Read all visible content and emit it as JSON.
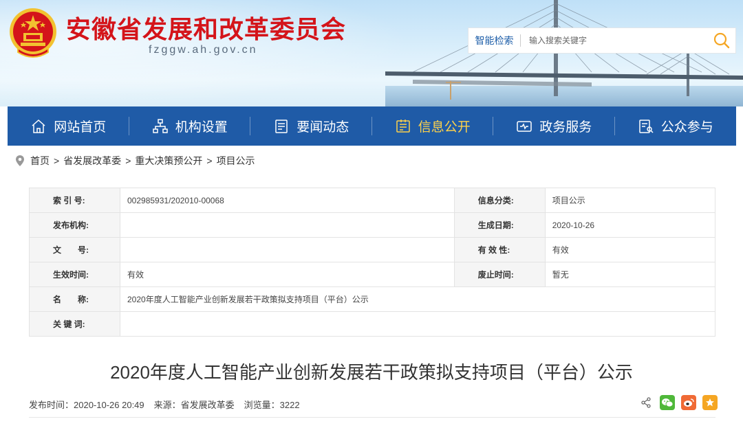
{
  "header": {
    "title": "安徽省发展和改革委员会",
    "domain": "fzggw.ah.gov.cn",
    "emblem_colors": {
      "red": "#d4141a",
      "gold": "#f2c230"
    }
  },
  "search": {
    "label": "智能检索",
    "placeholder": "输入搜索关键字",
    "icon": "search-icon"
  },
  "nav": {
    "items": [
      {
        "label": "网站首页",
        "icon": "home-icon"
      },
      {
        "label": "机构设置",
        "icon": "org-icon"
      },
      {
        "label": "要闻动态",
        "icon": "news-icon"
      },
      {
        "label": "信息公开",
        "icon": "info-icon"
      },
      {
        "label": "政务服务",
        "icon": "service-icon"
      },
      {
        "label": "公众参与",
        "icon": "participate-icon"
      }
    ],
    "active_index": 3,
    "bg_color": "#1f5ba7",
    "active_color": "#ffd24a"
  },
  "breadcrumb": {
    "items": [
      "首页",
      "省发展改革委",
      "重大决策预公开",
      "项目公示"
    ],
    "separator": ">"
  },
  "meta": {
    "index_label": "索 引 号:",
    "index_value": "002985931/202010-00068",
    "category_label": "信息分类:",
    "category_value": "项目公示",
    "publisher_label": "发布机构:",
    "publisher_value": "",
    "created_label": "生成日期:",
    "created_value": "2020-10-26",
    "docno_label": "文　　号:",
    "docno_value": "",
    "validity_label": "有 效 性:",
    "validity_value": "有效",
    "effective_label": "生效时间:",
    "effective_value": "有效",
    "expire_label": "废止时间:",
    "expire_value": "暂无",
    "name_label": "名　　称:",
    "name_value": "2020年度人工智能产业创新发展若干政策拟支持项目（平台）公示",
    "keywords_label": "关 键 词:",
    "keywords_value": ""
  },
  "article": {
    "title": "2020年度人工智能产业创新发展若干政策拟支持项目（平台）公示",
    "publish_time": "发布时间：2020-10-26 20:49",
    "source": "来源：省发展改革委",
    "views": "浏览量：3222"
  },
  "share": {
    "buttons": [
      {
        "icon": "share-icon",
        "color": "#666666"
      },
      {
        "icon": "wechat-icon",
        "color": "#4fb83a"
      },
      {
        "icon": "weibo-icon",
        "color": "#f06a35"
      },
      {
        "icon": "favorite-icon",
        "color": "#f5a623"
      }
    ]
  }
}
